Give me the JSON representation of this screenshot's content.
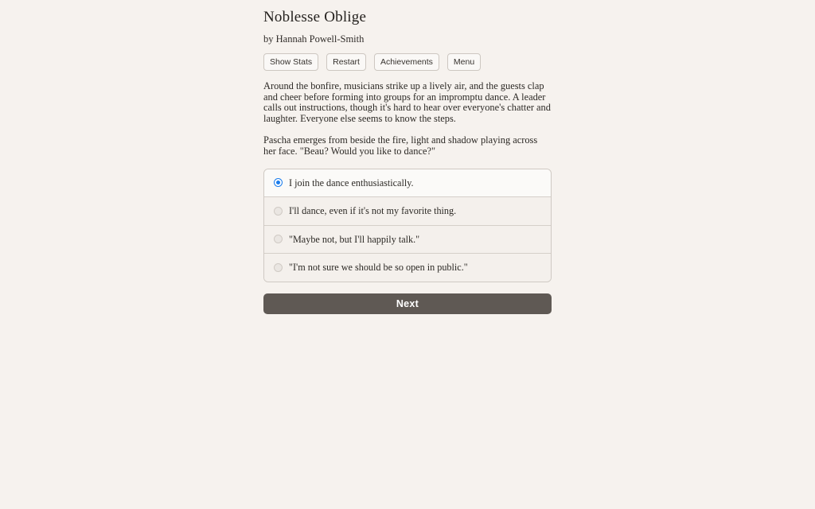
{
  "game": {
    "title": "Noblesse Oblige",
    "byline": "by Hannah Powell-Smith"
  },
  "toolbar": {
    "show_stats_label": "Show Stats",
    "restart_label": "Restart",
    "achievements_label": "Achievements",
    "menu_label": "Menu"
  },
  "story": {
    "paragraphs": [
      "Around the bonfire, musicians strike up a lively air, and the guests clap and cheer before forming into groups for an impromptu dance. A leader calls out instructions, though it's hard to hear over everyone's chatter and laughter. Everyone else seems to know the steps.",
      "Pascha emerges from beside the fire, light and shadow playing across her face. \"Beau? Would you like to dance?\""
    ]
  },
  "choices": [
    {
      "label": "I join the dance enthusiastically.",
      "selected": true
    },
    {
      "label": "I'll dance, even if it's not my favorite thing.",
      "selected": false
    },
    {
      "label": "\"Maybe not, but I'll happily talk.\"",
      "selected": false
    },
    {
      "label": "\"I'm not sure we should be so open in public.\"",
      "selected": false
    }
  ],
  "next_button": {
    "label": "Next"
  },
  "colors": {
    "background": "#f6f2ee",
    "accent_selected_radio": "#1b7ceb",
    "next_button_bg": "#5f5954"
  }
}
